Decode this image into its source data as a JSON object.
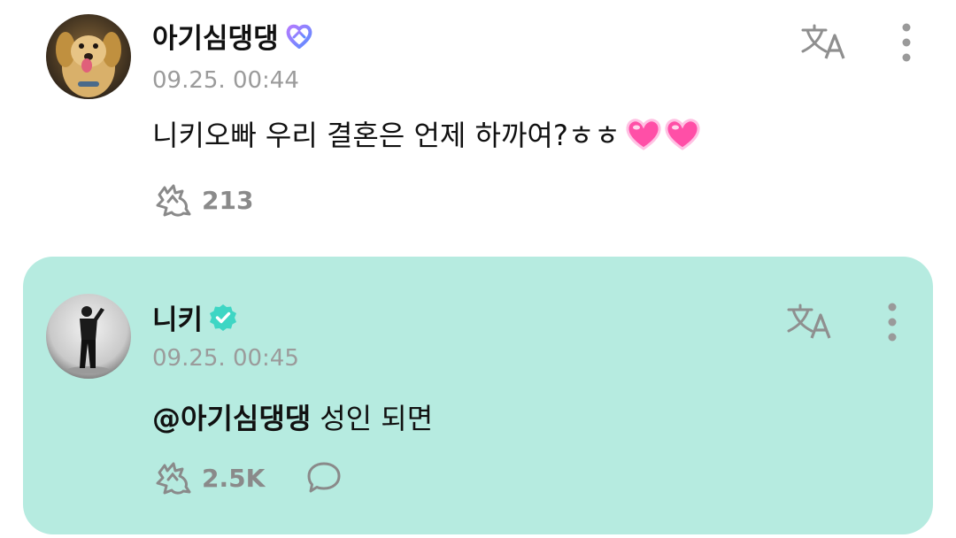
{
  "posts": [
    {
      "author": "아기심댕댕",
      "author_badge": "fan-heart-badge-icon",
      "timestamp": "09.25. 00:44",
      "text": "니키오빠 우리 결혼은 언제 하까여?ㅎㅎ",
      "emoji": "pink-heart-icon",
      "likes": "213"
    },
    {
      "author": "니키",
      "author_badge": "verified-badge-icon",
      "timestamp": "09.25. 00:45",
      "mention": "@아기심댕댕",
      "text": "성인 되면",
      "likes": "2.5K"
    }
  ],
  "colors": {
    "artist_background": "#b6ebe0",
    "secondary_text": "#9b9b9b",
    "verified_badge": "#3ed6c4",
    "fan_badge_gradient": [
      "#b37bff",
      "#5b8cff"
    ]
  }
}
